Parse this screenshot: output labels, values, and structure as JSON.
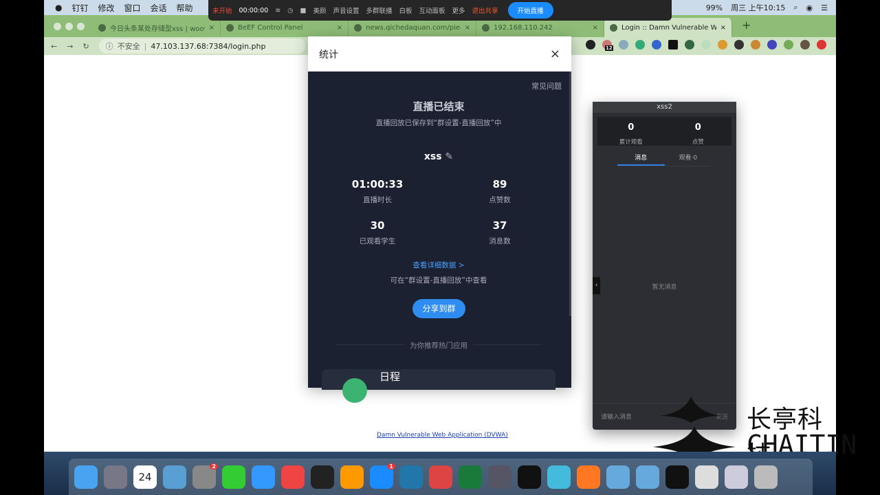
{
  "menubar": {
    "apple": "",
    "items": [
      "钉钉",
      "修改",
      "窗口",
      "会话",
      "帮助"
    ],
    "battery": "99%",
    "clock": "周三 上午10:15"
  },
  "dingtalk_bar": {
    "status": "未开始",
    "timer": "00:00:00",
    "beauty": "美颜",
    "audio": "声音设置",
    "multi": "多群联播",
    "whiteboard": "白板",
    "interact": "互动面板",
    "more": "更多",
    "exit": "退出共享",
    "start": "开始直播"
  },
  "tabs": [
    {
      "title": "今日头条某处存储型xss | wooyun",
      "close": "×"
    },
    {
      "title": "BeEF Control Panel",
      "close": "×"
    },
    {
      "title": "news.qichedaquan.com/piece/...",
      "close": "×"
    },
    {
      "title": "192.168.110.242",
      "close": "×"
    },
    {
      "title": "Login :: Damn Vulnerable Web A",
      "close": "×",
      "active": true
    }
  ],
  "new_tab": "+",
  "address": {
    "security": "不安全",
    "url": "47.103.137.68:7384/login.php"
  },
  "extension_badge": "12",
  "page": {
    "footer_link": "Damn Vulnerable Web Application (DVWA)"
  },
  "modal": {
    "title": "统计",
    "close": "×",
    "faq": "常见问题",
    "ended": "直播已结束",
    "saved": "直播回放已保存到“群设置-直播回放”中",
    "name": "xss",
    "stats": [
      {
        "value": "01:00:33",
        "label": "直播时长"
      },
      {
        "value": "89",
        "label": "点赞数"
      },
      {
        "value": "30",
        "label": "已观看学生"
      },
      {
        "value": "37",
        "label": "消息数"
      }
    ],
    "detail_link": "查看详细数据 >",
    "detail_hint": "可在“群设置-直播回放”中查看",
    "share": "分享到群",
    "recommend": "为你推荐热门应用",
    "app_card": "日程"
  },
  "panel": {
    "title": "xss2",
    "stats": [
      {
        "value": "0",
        "label": "累计观看"
      },
      {
        "value": "0",
        "label": "点赞"
      }
    ],
    "tabs": [
      "消息",
      "观看·0"
    ],
    "empty": "暂无消息",
    "input_placeholder": "请输入消息",
    "send": "发送"
  },
  "watermark": {
    "cn": "长亭科技",
    "en": "CHAITIN"
  },
  "dock": {
    "calendar_day": "24",
    "badges": [
      "2",
      "1"
    ]
  }
}
